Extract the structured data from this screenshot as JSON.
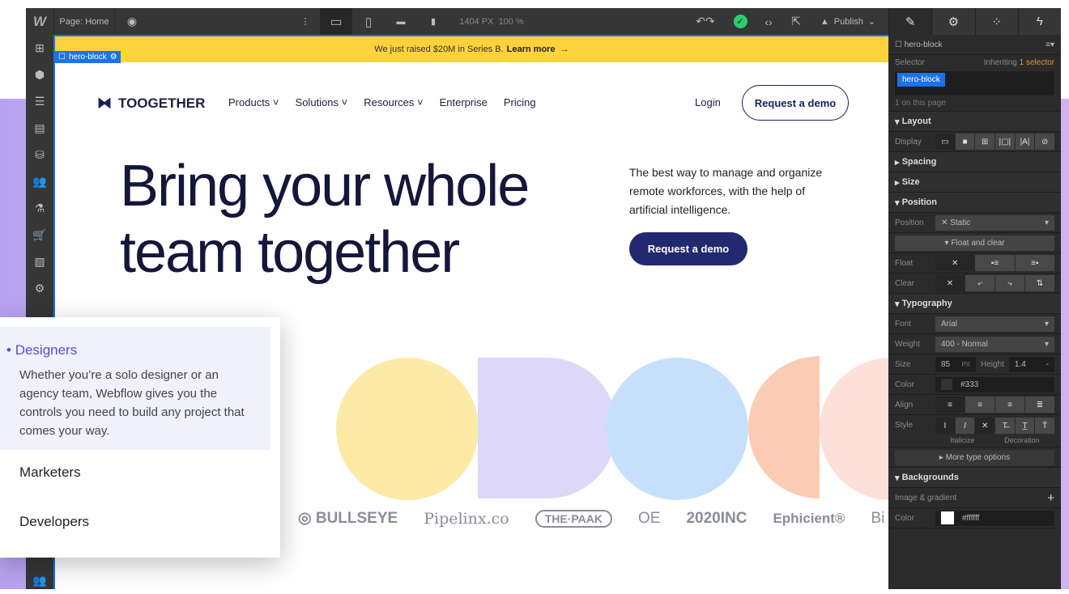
{
  "toolbar": {
    "logo": "W",
    "page": "Page: Home",
    "width": "1404 PX",
    "zoom": "100 %",
    "publish": "Publish"
  },
  "banner": {
    "text": "We just raised $20M in Series B.",
    "link": "Learn more",
    "arrow": "→"
  },
  "selection_tag": "hero-block",
  "site": {
    "brand": "TOOGETHER",
    "nav": [
      "Products",
      "Solutions",
      "Resources",
      "Enterprise",
      "Pricing"
    ],
    "login": "Login",
    "cta": "Request a demo",
    "hero_line1": "Bring your whole",
    "hero_line2": "team together",
    "subtitle": "The best way to manage and organize remote workforces, with the help of artificial intelligence.",
    "hero_cta": "Request a demo",
    "logos": [
      "◎ BULLSEYE",
      "Pipelinx.co",
      "THE·PAAK",
      "OE",
      "2020INC",
      "Ephicient®",
      "Bi"
    ]
  },
  "card": {
    "items": [
      {
        "title": "Designers",
        "text": "Whether you’re a solo designer or an agency team, Webflow gives you the controls you need to build any project that comes your way."
      },
      {
        "title": "Marketers"
      },
      {
        "title": "Developers"
      }
    ]
  },
  "panel": {
    "element": "hero-block",
    "selector_label": "Selector",
    "inheriting": "Inheriting",
    "inheriting_count": "1 selector",
    "selector_chip": "hero-block",
    "on_page": "1 on this page",
    "layout": "Layout",
    "display": "Display",
    "spacing": "Spacing",
    "size": "Size",
    "position_section": "Position",
    "position_label": "Position",
    "position_value": "Static",
    "float_clear": "Float and clear",
    "float": "Float",
    "clear": "Clear",
    "typography": "Typography",
    "font_label": "Font",
    "font": "Arial",
    "weight_label": "Weight",
    "weight": "400 - Normal",
    "size_label": "Size",
    "size_value": "85",
    "size_unit": "PX",
    "height_label": "Height",
    "height_value": "1.4",
    "color_label": "Color",
    "color_value": "#333",
    "align_label": "Align",
    "style_label": "Style",
    "italicize": "Italicize",
    "decoration": "Decoration",
    "more_type": "More type options",
    "backgrounds": "Backgrounds",
    "image_gradient": "Image & gradient",
    "bg_color_label": "Color",
    "bg_color": "#ffffff"
  },
  "colors": {
    "accent": "#1a73e8",
    "banner": "#fdd23c",
    "navy": "#23296e",
    "card_active": "#4f4fd9"
  }
}
